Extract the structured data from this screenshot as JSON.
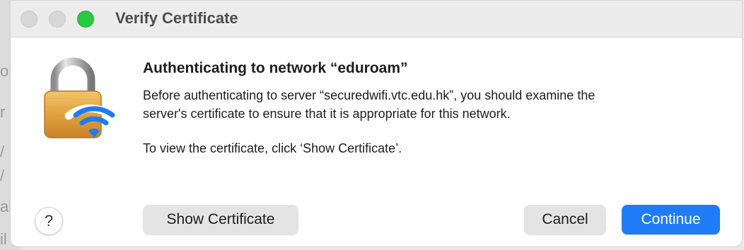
{
  "window": {
    "title": "Verify Certificate"
  },
  "background_window": {
    "letters": [
      "o",
      "r",
      "/",
      "/",
      "al",
      "il"
    ]
  },
  "dialog": {
    "heading": "Authenticating to network “eduroam”",
    "message_line1": "Before authenticating to server “securedwifi.vtc.edu.hk”, you should examine the",
    "message_line2": "server's certificate to ensure that it is appropriate for this network.",
    "instruction": "To view the certificate, click ‘Show Certificate’.",
    "icon": "lock-wifi-icon"
  },
  "buttons": {
    "help": "?",
    "show_certificate": "Show Certificate",
    "cancel": "Cancel",
    "continue": "Continue"
  },
  "colors": {
    "accent": "#1f7cf6",
    "zoom_green": "#29c840",
    "lock_gold": "#e0a23f"
  }
}
